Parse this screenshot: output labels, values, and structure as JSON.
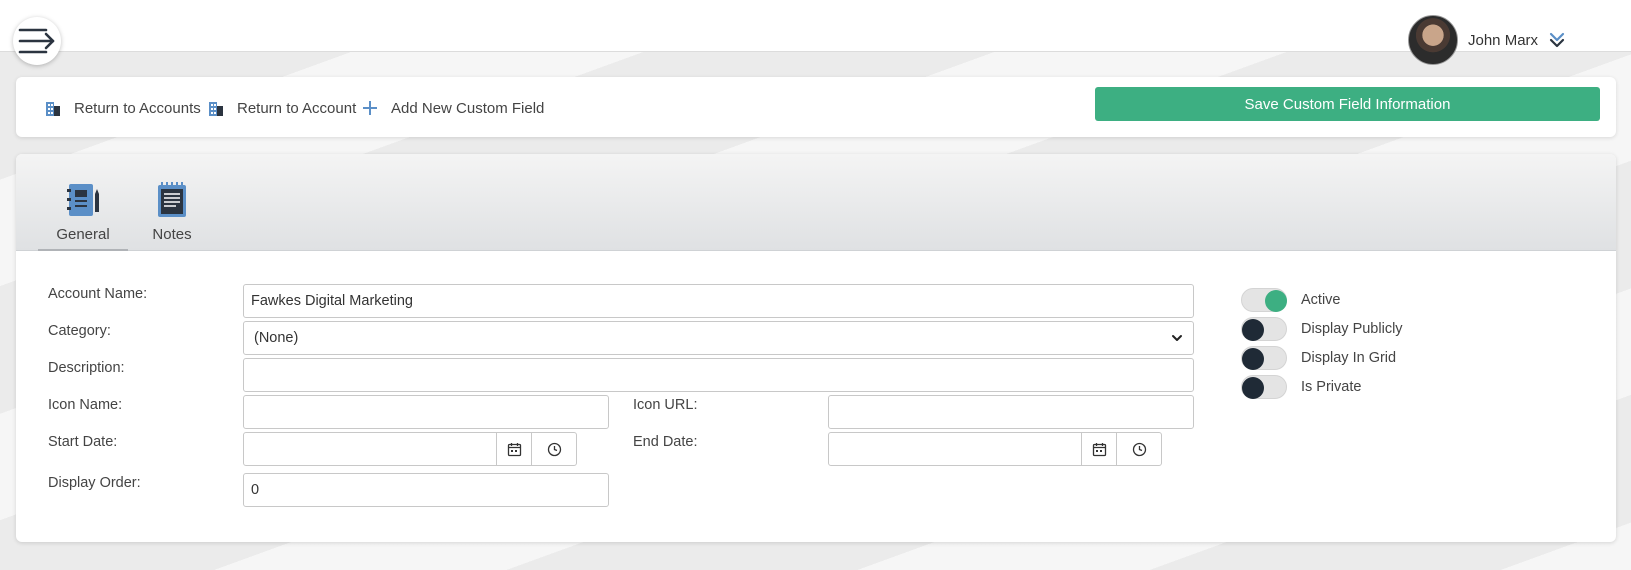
{
  "user": {
    "name": "John Marx"
  },
  "actions": {
    "return_accounts": "Return to Accounts",
    "return_account": "Return to Account",
    "add_custom_field": "Add New Custom Field",
    "save_label": "Save Custom Field Information"
  },
  "tabs": [
    {
      "label": "General",
      "icon": "notebook-pen-icon"
    },
    {
      "label": "Notes",
      "icon": "notepad-icon"
    }
  ],
  "form": {
    "account_name_label": "Account Name:",
    "account_name_value": "Fawkes Digital Marketing",
    "category_label": "Category:",
    "category_value": "(None)",
    "description_label": "Description:",
    "description_value": "",
    "icon_name_label": "Icon Name:",
    "icon_name_value": "",
    "icon_url_label": "Icon URL:",
    "icon_url_value": "",
    "start_date_label": "Start Date:",
    "start_date_value": "",
    "end_date_label": "End Date:",
    "end_date_value": "",
    "display_order_label": "Display Order:",
    "display_order_value": "0"
  },
  "toggles": [
    {
      "label": "Active",
      "state": "on"
    },
    {
      "label": "Display Publicly",
      "state": "off"
    },
    {
      "label": "Display In Grid",
      "state": "off"
    },
    {
      "label": "Is Private",
      "state": "off"
    }
  ],
  "colors": {
    "accent": "#3daf82",
    "knob_off": "#1f2a36",
    "icon_blue": "#5b8fc7"
  }
}
